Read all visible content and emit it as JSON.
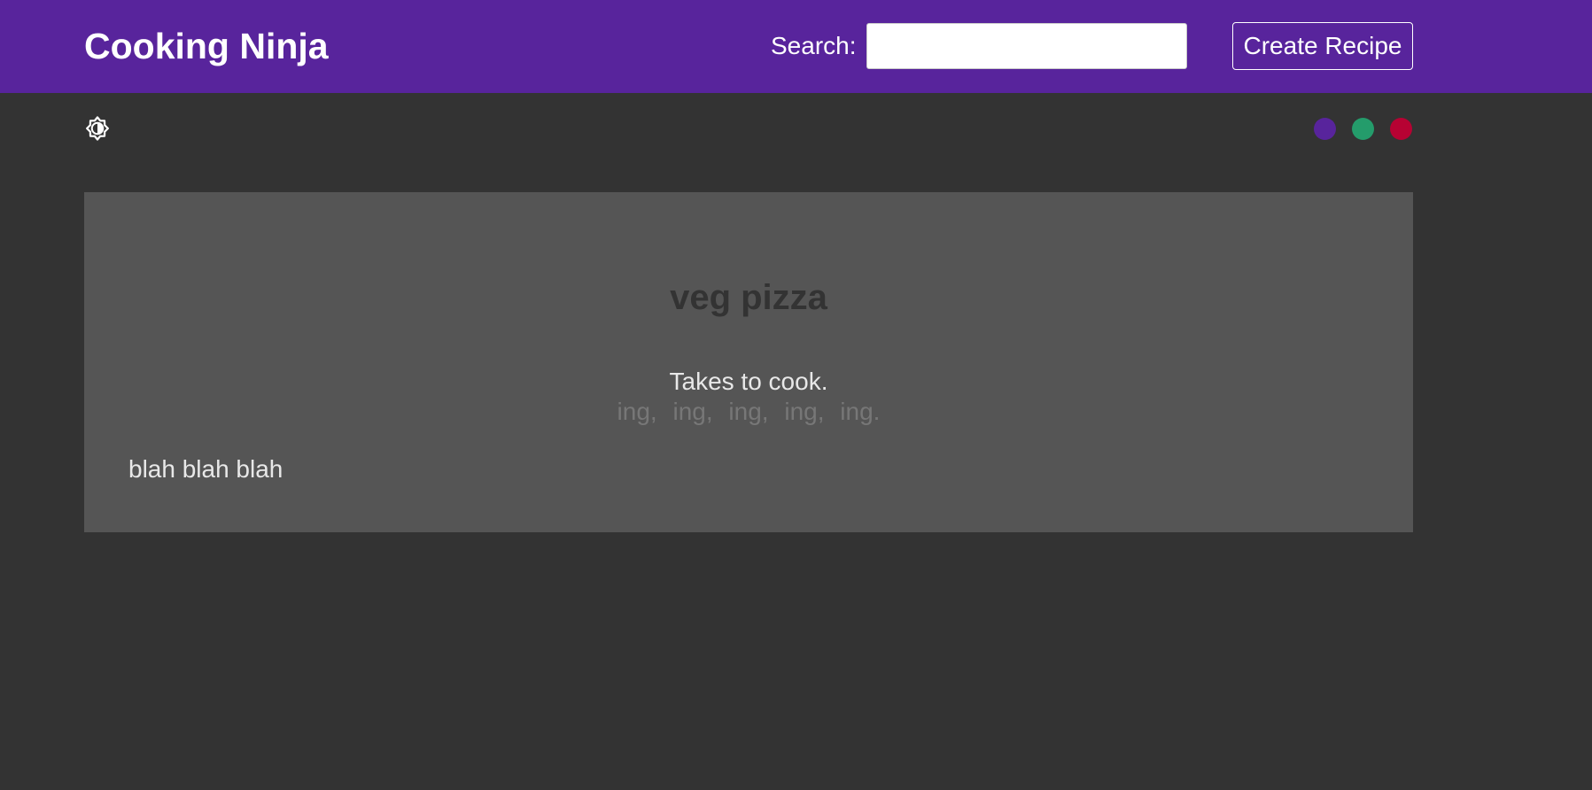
{
  "navbar": {
    "brand": "Cooking Ninja",
    "search_label": "Search:",
    "search_value": "",
    "create_label": "Create Recipe",
    "background_color": "#58249c"
  },
  "theme": {
    "mode_icon": "brightness-icon",
    "swatches": [
      {
        "name": "purple",
        "color": "#58249c"
      },
      {
        "name": "green",
        "color": "#249c6b"
      },
      {
        "name": "red",
        "color": "#b70233"
      }
    ]
  },
  "recipe": {
    "title": "veg pizza",
    "time": "Takes to cook.",
    "ingredients": [
      "ing,",
      "ing,",
      "ing,",
      "ing,",
      "ing."
    ],
    "method": "blah blah blah"
  }
}
